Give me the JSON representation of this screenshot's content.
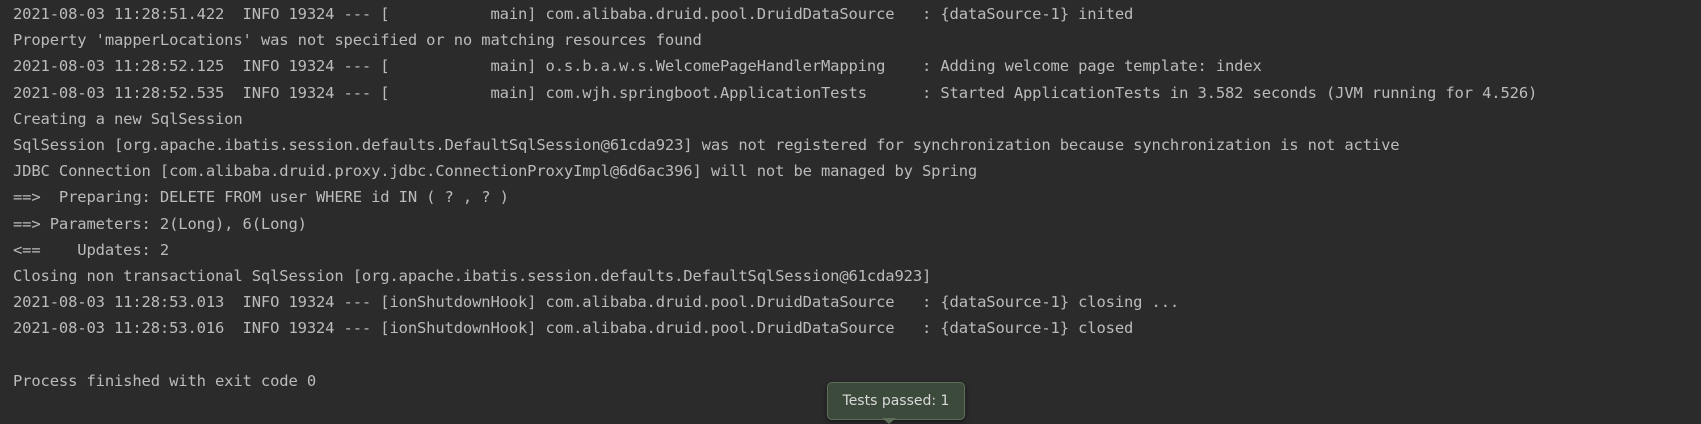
{
  "console": {
    "lines": [
      "2021-08-03 11:28:51.422  INFO 19324 --- [           main] com.alibaba.druid.pool.DruidDataSource   : {dataSource-1} inited",
      "Property 'mapperLocations' was not specified or no matching resources found",
      "2021-08-03 11:28:52.125  INFO 19324 --- [           main] o.s.b.a.w.s.WelcomePageHandlerMapping    : Adding welcome page template: index",
      "2021-08-03 11:28:52.535  INFO 19324 --- [           main] com.wjh.springboot.ApplicationTests      : Started ApplicationTests in 3.582 seconds (JVM running for 4.526)",
      "Creating a new SqlSession",
      "SqlSession [org.apache.ibatis.session.defaults.DefaultSqlSession@61cda923] was not registered for synchronization because synchronization is not active",
      "JDBC Connection [com.alibaba.druid.proxy.jdbc.ConnectionProxyImpl@6d6ac396] will not be managed by Spring",
      "==>  Preparing: DELETE FROM user WHERE id IN ( ? , ? )",
      "==> Parameters: 2(Long), 6(Long)",
      "<==    Updates: 2",
      "Closing non transactional SqlSession [org.apache.ibatis.session.defaults.DefaultSqlSession@61cda923]",
      "2021-08-03 11:28:53.013  INFO 19324 --- [ionShutdownHook] com.alibaba.druid.pool.DruidDataSource   : {dataSource-1} closing ...",
      "2021-08-03 11:28:53.016  INFO 19324 --- [ionShutdownHook] com.alibaba.druid.pool.DruidDataSource   : {dataSource-1} closed",
      "",
      "Process finished with exit code 0"
    ]
  },
  "tooltip": {
    "text": "Tests passed: 1"
  },
  "colors": {
    "background": "#2b2b2b",
    "text": "#bbbbbb",
    "tooltip_background": "#3c4a3c",
    "tooltip_border": "#5d6f5a"
  }
}
